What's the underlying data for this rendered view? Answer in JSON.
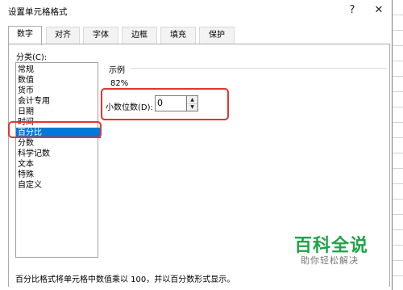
{
  "dialog": {
    "title": "设置单元格格式",
    "help_glyph": "?",
    "close_glyph": "✕"
  },
  "tabs": [
    {
      "label": "数字",
      "active": true
    },
    {
      "label": "对齐"
    },
    {
      "label": "字体"
    },
    {
      "label": "边框"
    },
    {
      "label": "填充"
    },
    {
      "label": "保护"
    }
  ],
  "category": {
    "label": "分类(C):",
    "items": [
      "常规",
      "数值",
      "货币",
      "会计专用",
      "日期",
      "时间",
      "百分比",
      "分数",
      "科学记数",
      "文本",
      "特殊",
      "自定义"
    ],
    "selected": "百分比"
  },
  "sample": {
    "label": "示例",
    "value": "82%"
  },
  "decimal_places": {
    "label": "小数位数(D):",
    "value": "0",
    "up_icon": "▲",
    "down_icon": "▼"
  },
  "description": "百分比格式将单元格中数值乘以 100，并以百分数形式显示。",
  "watermark": {
    "main": "百科全说",
    "sub": "助你轻松解决"
  },
  "colors": {
    "selection": "#0078d7",
    "highlight_border": "#e2352f",
    "watermark": "#1fa34a"
  }
}
